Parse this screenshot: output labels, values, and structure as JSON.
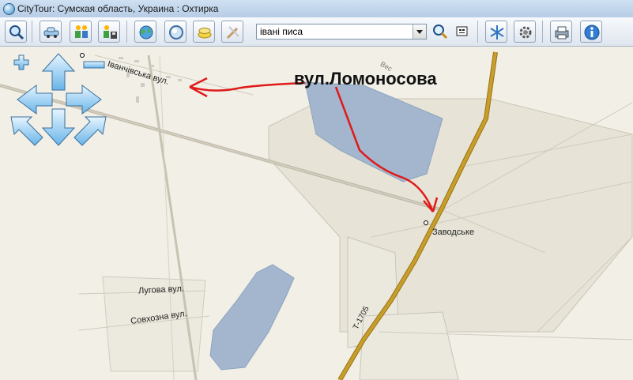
{
  "window": {
    "title": "CityTour: Сумская область, Украина : Охтирка"
  },
  "toolbar": {
    "search_value": "івані писа",
    "buttons": [
      {
        "icon": "magnifier-icon"
      },
      {
        "icon": "car-icon"
      },
      {
        "icon": "route-people-icon"
      },
      {
        "icon": "route-save-icon"
      },
      {
        "icon": "globe-icon"
      },
      {
        "icon": "sphere-icon"
      },
      {
        "icon": "layers-icon"
      },
      {
        "icon": "tools-icon"
      },
      {
        "icon": "search-go-icon"
      },
      {
        "icon": "coordinates-icon"
      },
      {
        "icon": "snowflake-settings-icon"
      },
      {
        "icon": "gear-icon"
      },
      {
        "icon": "printer-icon"
      },
      {
        "icon": "info-icon"
      }
    ]
  },
  "map": {
    "labels": {
      "street_top": "Іванчівська вул.",
      "lugova": "Лугова вул.",
      "sovkhozna": "Совхозна вул.",
      "village": "Заводське",
      "road_code": "Т-1705",
      "small_top": "Вес"
    },
    "annotation": "вул.Ломоносова",
    "colors": {
      "water": "#a3b6cd",
      "main_road": "#b8902a",
      "arrow": "#e01a1a"
    }
  }
}
